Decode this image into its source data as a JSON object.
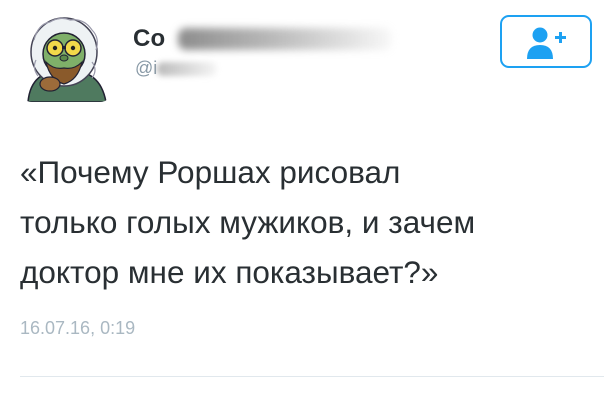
{
  "user": {
    "display_name": "Со",
    "username": "@i",
    "avatar_icon": "cartoon-eskimo-avatar-icon"
  },
  "follow_button": {
    "icon": "add-user-icon",
    "color": "#1da1f2"
  },
  "tweet": {
    "lines": [
      "«Почему Роршах рисовал",
      "только голых мужиков, и зачем",
      "доктор мне их показывает?»"
    ],
    "timestamp": "16.07.16, 0:19"
  }
}
